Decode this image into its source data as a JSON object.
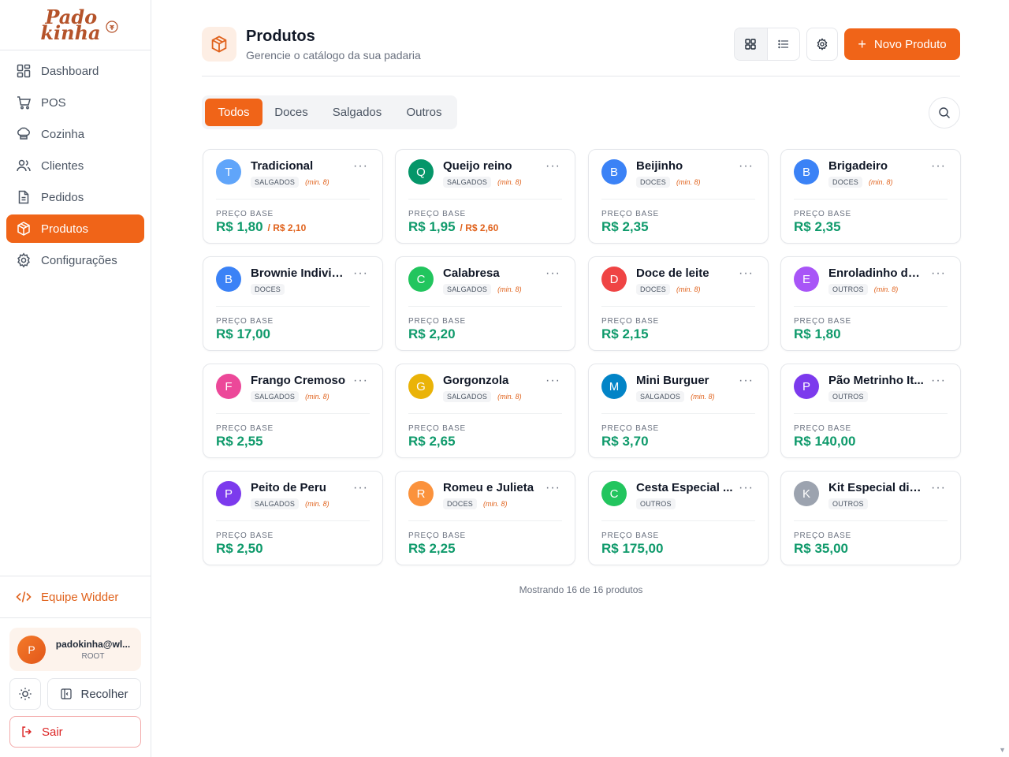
{
  "brand": {
    "line1": "Pado",
    "line2": "kinha"
  },
  "sidebar": {
    "items": [
      {
        "label": "Dashboard",
        "icon": "dashboard-icon"
      },
      {
        "label": "POS",
        "icon": "cart-icon"
      },
      {
        "label": "Cozinha",
        "icon": "chef-hat-icon"
      },
      {
        "label": "Clientes",
        "icon": "users-icon"
      },
      {
        "label": "Pedidos",
        "icon": "file-icon"
      },
      {
        "label": "Produtos",
        "icon": "box-icon",
        "active": true
      },
      {
        "label": "Configurações",
        "icon": "gear-icon"
      }
    ],
    "team_link": "Equipe Widder",
    "user": {
      "initial": "P",
      "email": "padokinha@wl...",
      "role": "ROOT"
    },
    "collapse_label": "Recolher",
    "logout_label": "Sair"
  },
  "header": {
    "title": "Produtos",
    "subtitle": "Gerencie o catálogo da sua padaria",
    "new_button": "Novo Produto"
  },
  "tabs": [
    {
      "label": "Todos",
      "active": true
    },
    {
      "label": "Doces"
    },
    {
      "label": "Salgados"
    },
    {
      "label": "Outros"
    }
  ],
  "price_label": "PREÇO BASE",
  "products": [
    {
      "initial": "T",
      "name": "Tradicional",
      "category": "SALGADOS",
      "min": "(min. 8)",
      "price": "R$ 1,80",
      "alt_price": "/ R$ 2,10",
      "color": "#60a5fa"
    },
    {
      "initial": "Q",
      "name": "Queijo reino",
      "category": "SALGADOS",
      "min": "(min. 8)",
      "price": "R$ 1,95",
      "alt_price": "/ R$ 2,60",
      "color": "#059669"
    },
    {
      "initial": "B",
      "name": "Beijinho",
      "category": "DOCES",
      "min": "(min. 8)",
      "price": "R$ 2,35",
      "alt_price": "",
      "color": "#3b82f6"
    },
    {
      "initial": "B",
      "name": "Brigadeiro",
      "category": "DOCES",
      "min": "(min. 8)",
      "price": "R$ 2,35",
      "alt_price": "",
      "color": "#3b82f6"
    },
    {
      "initial": "B",
      "name": "Brownie Individ...",
      "category": "DOCES",
      "min": "",
      "price": "R$ 17,00",
      "alt_price": "",
      "color": "#3b82f6"
    },
    {
      "initial": "C",
      "name": "Calabresa",
      "category": "SALGADOS",
      "min": "(min. 8)",
      "price": "R$ 2,20",
      "alt_price": "",
      "color": "#22c55e"
    },
    {
      "initial": "D",
      "name": "Doce de leite",
      "category": "DOCES",
      "min": "(min. 8)",
      "price": "R$ 2,15",
      "alt_price": "",
      "color": "#ef4444"
    },
    {
      "initial": "E",
      "name": "Enroladinho de ...",
      "category": "OUTROS",
      "min": "(min. 8)",
      "price": "R$ 1,80",
      "alt_price": "",
      "color": "#a855f7"
    },
    {
      "initial": "F",
      "name": "Frango Cremoso",
      "category": "SALGADOS",
      "min": "(min. 8)",
      "price": "R$ 2,55",
      "alt_price": "",
      "color": "#ec4899"
    },
    {
      "initial": "G",
      "name": "Gorgonzola",
      "category": "SALGADOS",
      "min": "(min. 8)",
      "price": "R$ 2,65",
      "alt_price": "",
      "color": "#eab308"
    },
    {
      "initial": "M",
      "name": "Mini Burguer",
      "category": "SALGADOS",
      "min": "(min. 8)",
      "price": "R$ 3,70",
      "alt_price": "",
      "color": "#0284c7"
    },
    {
      "initial": "P",
      "name": "Pão Metrinho It...",
      "category": "OUTROS",
      "min": "",
      "price": "R$ 140,00",
      "alt_price": "",
      "color": "#7c3aed"
    },
    {
      "initial": "P",
      "name": "Peito de Peru",
      "category": "SALGADOS",
      "min": "(min. 8)",
      "price": "R$ 2,50",
      "alt_price": "",
      "color": "#7c3aed"
    },
    {
      "initial": "R",
      "name": "Romeu e Julieta",
      "category": "DOCES",
      "min": "(min. 8)",
      "price": "R$ 2,25",
      "alt_price": "",
      "color": "#fb923c"
    },
    {
      "initial": "C",
      "name": "Cesta Especial ...",
      "category": "OUTROS",
      "min": "",
      "price": "R$ 175,00",
      "alt_price": "",
      "color": "#22c55e"
    },
    {
      "initial": "K",
      "name": "Kit Especial dia ...",
      "category": "OUTROS",
      "min": "",
      "price": "R$ 35,00",
      "alt_price": "",
      "color": "#9ca3af"
    }
  ],
  "footer": {
    "count_text": "Mostrando 16 de 16 produtos"
  }
}
